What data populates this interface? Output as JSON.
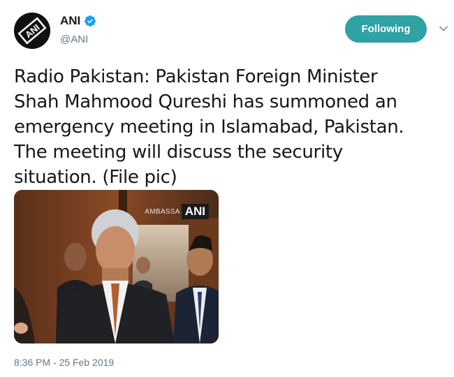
{
  "author": {
    "name": "ANI",
    "handle": "@ANI",
    "verified": true,
    "avatar_icon": "ani-logo",
    "avatar_text": "ANI"
  },
  "follow_button": {
    "label": "Following",
    "color": "#2fa2a3"
  },
  "menu_icon": "chevron-down-icon",
  "tweet": {
    "lines": [
      "Radio Pakistan: Pakistan Foreign Minister",
      "Shah Mahmood Qureshi has summoned an",
      "emergency meeting in Islamabad, Pakistan.",
      "The meeting will discuss the security",
      "situation. (File pic)"
    ]
  },
  "media": {
    "watermark_small": "AMBASSA",
    "watermark_logo": "ANI"
  },
  "timestamp": "8:36 PM - 25 Feb 2019"
}
